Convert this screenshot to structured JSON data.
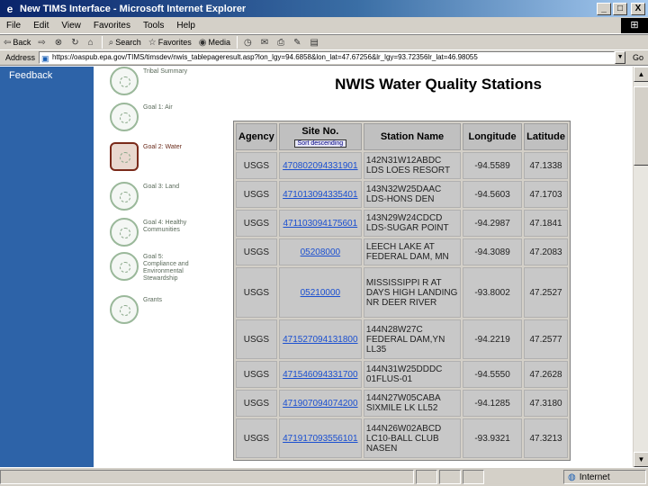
{
  "window": {
    "title": "New TIMS Interface - Microsoft Internet Explorer",
    "minimize": "_",
    "maximize": "□",
    "close": "X"
  },
  "menu": [
    "File",
    "Edit",
    "View",
    "Favorites",
    "Tools",
    "Help"
  ],
  "toolbar": {
    "back": "Back",
    "search": "Search",
    "favorites": "Favorites",
    "media": "Media"
  },
  "address": {
    "label": "Address",
    "url": "https://oaspub.epa.gov/TIMS/timsdev/nwis_tablepageresult.asp?lon_lgy=94.6858&lon_lat=47.67256&lr_lgy=93.72356lr_lat=46.98055",
    "go": "Go"
  },
  "sidebar": {
    "feedback": "Feedback"
  },
  "nav": [
    {
      "label": "Tribal Summary"
    },
    {
      "label": "Goal 1: Air"
    },
    {
      "label": "Goal 2: Water"
    },
    {
      "label": "Goal 3: Land"
    },
    {
      "label": "Goal 4: Healthy Communities"
    },
    {
      "label": "Goal 5: Compliance and Environmental Stewardship"
    },
    {
      "label": "Grants"
    }
  ],
  "page": {
    "title": "NWIS Water Quality Stations",
    "sort_button": "Sort descending"
  },
  "table": {
    "headers": [
      "Agency",
      "Site No.",
      "Station Name",
      "Longitude",
      "Latitude"
    ],
    "rows": [
      {
        "agency": "USGS",
        "site": "470802094331901",
        "name": "142N31W12ABDC LDS LOES RESORT",
        "lon": "-94.5589",
        "lat": "47.1338"
      },
      {
        "agency": "USGS",
        "site": "471013094335401",
        "name": "143N32W25DAAC LDS-HONS DEN",
        "lon": "-94.5603",
        "lat": "47.1703"
      },
      {
        "agency": "USGS",
        "site": "471103094175601",
        "name": "143N29W24CDCD LDS-SUGAR POINT",
        "lon": "-94.2987",
        "lat": "47.1841"
      },
      {
        "agency": "USGS",
        "site": "05208000",
        "name": "LEECH LAKE AT FEDERAL DAM, MN",
        "lon": "-94.3089",
        "lat": "47.2083"
      },
      {
        "agency": "USGS",
        "site": "05210000",
        "name": "MISSISSIPPI R AT DAYS HIGH LANDING NR DEER RIVER",
        "lon": "-93.8002",
        "lat": "47.2527"
      },
      {
        "agency": "USGS",
        "site": "471527094131800",
        "name": "144N28W27C FEDERAL DAM,YN LL35",
        "lon": "-94.2219",
        "lat": "47.2577"
      },
      {
        "agency": "USGS",
        "site": "471546094331700",
        "name": "144N31W25DDDC 01FLUS-01",
        "lon": "-94.5550",
        "lat": "47.2628"
      },
      {
        "agency": "USGS",
        "site": "471907094074200",
        "name": "144N27W05CABA SIXMILE LK LL52",
        "lon": "-94.1285",
        "lat": "47.3180"
      },
      {
        "agency": "USGS",
        "site": "471917093556101",
        "name": "144N26W02ABCD LC10-BALL CLUB NASEN",
        "lon": "-93.9321",
        "lat": "47.3213"
      }
    ]
  },
  "status": {
    "zone": "Internet"
  }
}
